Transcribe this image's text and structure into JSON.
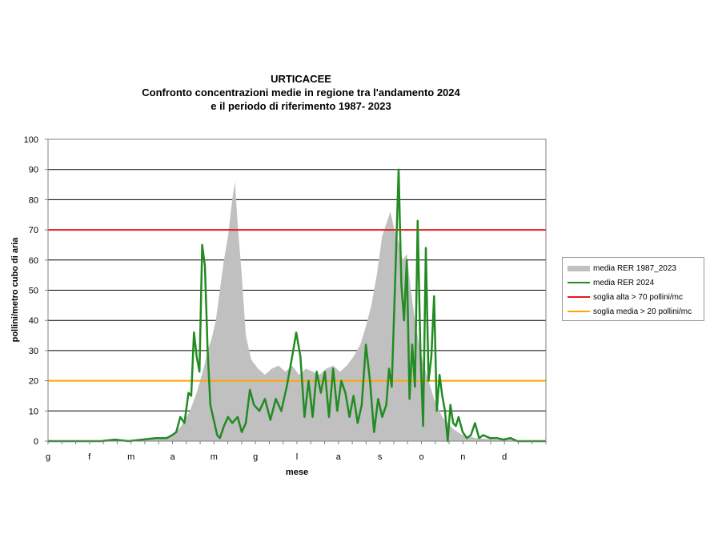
{
  "chart_data": {
    "type": "area",
    "title": "URTICACEE",
    "subtitle": "Confronto concentrazioni medie in regione tra l'andamento 2024\ne il periodo di riferimento 1987- 2023",
    "title_line2": "Confronto concentrazioni medie in regione tra l'andamento 2024",
    "title_line3": "e il periodo di riferimento 1987- 2023",
    "xlabel": "mese",
    "ylabel": "pollini/metro cubo di aria",
    "ylim": [
      0,
      100
    ],
    "yticks": [
      0,
      10,
      20,
      30,
      40,
      50,
      60,
      70,
      80,
      90,
      100
    ],
    "xticks": [
      "g",
      "f",
      "m",
      "a",
      "m",
      "g",
      "l",
      "a",
      "s",
      "o",
      "n",
      "d"
    ],
    "xlim_days": [
      1,
      366
    ],
    "grid": "horizontal",
    "legend_position": "right",
    "series": [
      {
        "name": "media RER 1987_2023",
        "type": "area",
        "color": "#c0c0c0",
        "points": [
          [
            1,
            0
          ],
          [
            60,
            0
          ],
          [
            75,
            0.5
          ],
          [
            85,
            1
          ],
          [
            92,
            2
          ],
          [
            97,
            4
          ],
          [
            100,
            6
          ],
          [
            105,
            10
          ],
          [
            110,
            16
          ],
          [
            115,
            24
          ],
          [
            118,
            30
          ],
          [
            121,
            34
          ],
          [
            124,
            40
          ],
          [
            127,
            50
          ],
          [
            130,
            60
          ],
          [
            133,
            68
          ],
          [
            136,
            80
          ],
          [
            138,
            86
          ],
          [
            140,
            72
          ],
          [
            143,
            55
          ],
          [
            146,
            35
          ],
          [
            150,
            27
          ],
          [
            155,
            24
          ],
          [
            160,
            22
          ],
          [
            165,
            24
          ],
          [
            170,
            25
          ],
          [
            175,
            23
          ],
          [
            180,
            25
          ],
          [
            185,
            22
          ],
          [
            190,
            24
          ],
          [
            195,
            23
          ],
          [
            200,
            22
          ],
          [
            205,
            24
          ],
          [
            210,
            25
          ],
          [
            215,
            23
          ],
          [
            220,
            25
          ],
          [
            225,
            28
          ],
          [
            230,
            32
          ],
          [
            234,
            38
          ],
          [
            238,
            45
          ],
          [
            242,
            55
          ],
          [
            246,
            68
          ],
          [
            249,
            72
          ],
          [
            252,
            76
          ],
          [
            255,
            70
          ],
          [
            258,
            66
          ],
          [
            261,
            60
          ],
          [
            264,
            62
          ],
          [
            267,
            50
          ],
          [
            270,
            40
          ],
          [
            273,
            32
          ],
          [
            276,
            26
          ],
          [
            280,
            20
          ],
          [
            284,
            14
          ],
          [
            290,
            8
          ],
          [
            298,
            4
          ],
          [
            305,
            2
          ],
          [
            315,
            1
          ],
          [
            330,
            0.5
          ],
          [
            366,
            0
          ]
        ]
      },
      {
        "name": "media RER 2024",
        "type": "line",
        "color": "#228B22",
        "points": [
          [
            1,
            0
          ],
          [
            40,
            0
          ],
          [
            50,
            0.5
          ],
          [
            60,
            0
          ],
          [
            70,
            0.5
          ],
          [
            80,
            1
          ],
          [
            88,
            1
          ],
          [
            92,
            2
          ],
          [
            95,
            3
          ],
          [
            98,
            8
          ],
          [
            101,
            6
          ],
          [
            104,
            16
          ],
          [
            106,
            15
          ],
          [
            108,
            36
          ],
          [
            110,
            28
          ],
          [
            112,
            23
          ],
          [
            114,
            65
          ],
          [
            116,
            58
          ],
          [
            118,
            30
          ],
          [
            120,
            12
          ],
          [
            123,
            6
          ],
          [
            125,
            2
          ],
          [
            127,
            1
          ],
          [
            130,
            5
          ],
          [
            133,
            8
          ],
          [
            136,
            6
          ],
          [
            140,
            8
          ],
          [
            143,
            3
          ],
          [
            146,
            6
          ],
          [
            149,
            17
          ],
          [
            152,
            12
          ],
          [
            156,
            10
          ],
          [
            160,
            14
          ],
          [
            164,
            7
          ],
          [
            168,
            14
          ],
          [
            172,
            10
          ],
          [
            176,
            18
          ],
          [
            180,
            28
          ],
          [
            183,
            36
          ],
          [
            186,
            28
          ],
          [
            189,
            8
          ],
          [
            192,
            20
          ],
          [
            195,
            8
          ],
          [
            198,
            23
          ],
          [
            201,
            16
          ],
          [
            204,
            23
          ],
          [
            207,
            8
          ],
          [
            210,
            24
          ],
          [
            213,
            10
          ],
          [
            216,
            20
          ],
          [
            219,
            16
          ],
          [
            222,
            8
          ],
          [
            225,
            15
          ],
          [
            228,
            6
          ],
          [
            231,
            12
          ],
          [
            234,
            32
          ],
          [
            237,
            20
          ],
          [
            240,
            3
          ],
          [
            243,
            14
          ],
          [
            246,
            8
          ],
          [
            249,
            12
          ],
          [
            251,
            24
          ],
          [
            253,
            18
          ],
          [
            256,
            60
          ],
          [
            258,
            90
          ],
          [
            260,
            52
          ],
          [
            262,
            40
          ],
          [
            264,
            60
          ],
          [
            266,
            14
          ],
          [
            268,
            32
          ],
          [
            270,
            18
          ],
          [
            272,
            73
          ],
          [
            274,
            30
          ],
          [
            276,
            5
          ],
          [
            278,
            64
          ],
          [
            280,
            20
          ],
          [
            282,
            28
          ],
          [
            284,
            48
          ],
          [
            286,
            10
          ],
          [
            288,
            22
          ],
          [
            290,
            15
          ],
          [
            292,
            10
          ],
          [
            294,
            0
          ],
          [
            296,
            12
          ],
          [
            298,
            6
          ],
          [
            300,
            5
          ],
          [
            302,
            8
          ],
          [
            305,
            3
          ],
          [
            308,
            1
          ],
          [
            311,
            2
          ],
          [
            314,
            6
          ],
          [
            317,
            1
          ],
          [
            320,
            2
          ],
          [
            325,
            1
          ],
          [
            330,
            1
          ],
          [
            335,
            0.5
          ],
          [
            340,
            1
          ],
          [
            345,
            0
          ],
          [
            366,
            0
          ]
        ]
      },
      {
        "name": "soglia alta > 70 pollini/mc",
        "type": "hline",
        "color": "#e31a1c",
        "value": 70
      },
      {
        "name": "soglia media > 20 pollini/mc",
        "type": "hline",
        "color": "#ffa500",
        "value": 20
      }
    ]
  }
}
